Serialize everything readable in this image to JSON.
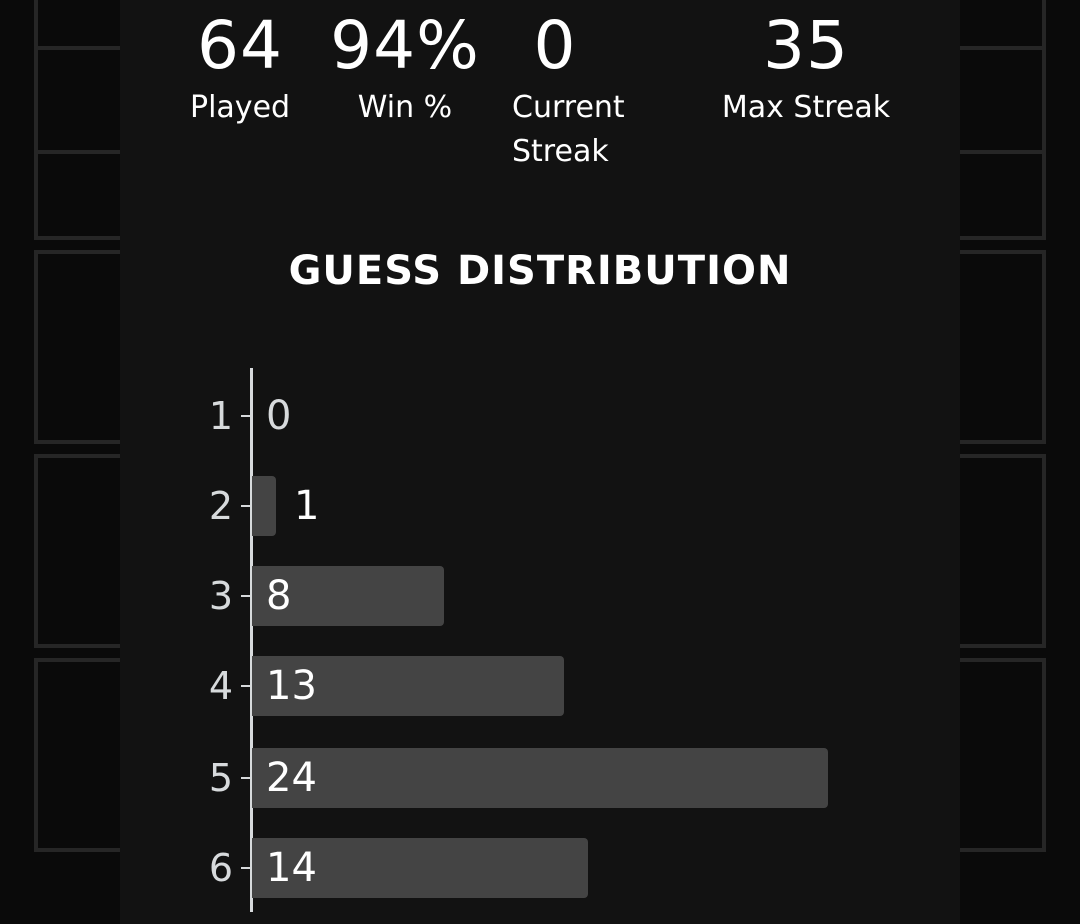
{
  "stats": [
    {
      "value": "64",
      "label": "Played"
    },
    {
      "value": "94%",
      "label": "Win %"
    },
    {
      "value": "0",
      "label": "Current Streak"
    },
    {
      "value": "35",
      "label": "Max Streak"
    }
  ],
  "distribution_title": "GUESS DISTRIBUTION",
  "colors": {
    "background": "#0a0a0a",
    "modal": "#121212",
    "bar": "#444444",
    "tile_border": "#262626",
    "axis": "#d7dadc"
  },
  "chart_data": {
    "type": "bar",
    "orientation": "horizontal",
    "categories": [
      "1",
      "2",
      "3",
      "4",
      "5",
      "6"
    ],
    "values": [
      0,
      1,
      8,
      13,
      24,
      14
    ],
    "title": "GUESS DISTRIBUTION",
    "xlim": [
      0,
      24
    ]
  }
}
